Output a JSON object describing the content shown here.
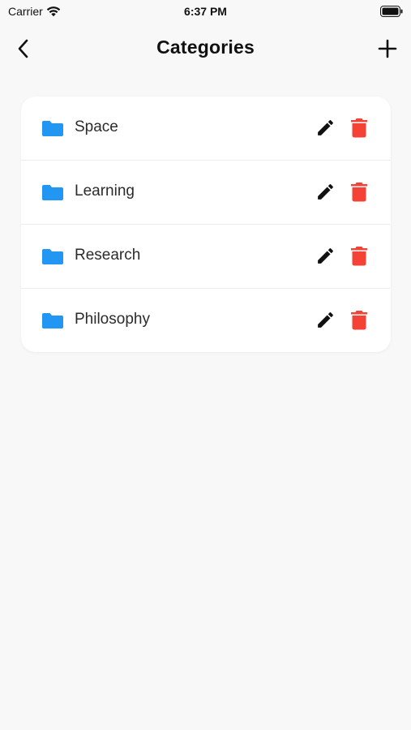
{
  "status_bar": {
    "carrier": "Carrier",
    "time": "6:37 PM"
  },
  "nav": {
    "title": "Categories",
    "back_icon": "chevron-left-icon",
    "add_icon": "plus-icon"
  },
  "categories": [
    {
      "label": "Space",
      "icon": "folder-icon"
    },
    {
      "label": "Learning",
      "icon": "folder-icon"
    },
    {
      "label": "Research",
      "icon": "folder-icon"
    },
    {
      "label": "Philosophy",
      "icon": "folder-icon"
    }
  ],
  "colors": {
    "folder": "#2196F3",
    "delete": "#F44336",
    "edit": "#111111",
    "background": "#F8F8F8",
    "card": "#FFFFFF"
  }
}
